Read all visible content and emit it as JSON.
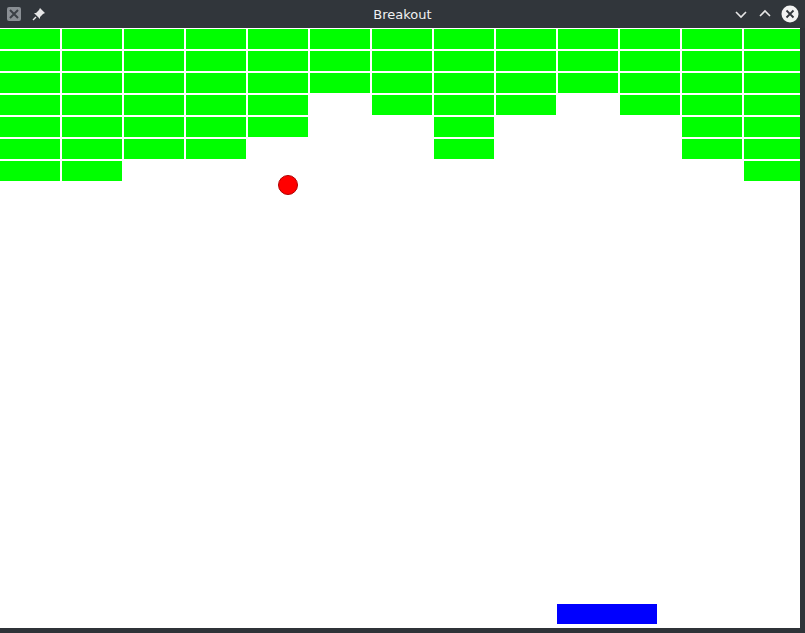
{
  "window": {
    "title": "Breakout"
  },
  "bricks": [
    [
      true,
      true,
      true,
      true,
      true,
      true,
      true,
      true,
      true,
      true,
      true,
      true,
      true
    ],
    [
      true,
      true,
      true,
      true,
      true,
      true,
      true,
      true,
      true,
      true,
      true,
      true,
      true
    ],
    [
      true,
      true,
      true,
      true,
      true,
      true,
      true,
      true,
      true,
      true,
      true,
      true,
      true
    ],
    [
      true,
      true,
      true,
      true,
      true,
      false,
      true,
      true,
      true,
      false,
      true,
      true,
      true
    ],
    [
      true,
      true,
      true,
      true,
      true,
      false,
      false,
      true,
      false,
      false,
      false,
      true,
      true
    ],
    [
      true,
      true,
      true,
      true,
      false,
      false,
      false,
      true,
      false,
      false,
      false,
      true,
      true
    ],
    [
      true,
      true,
      false,
      false,
      false,
      false,
      false,
      false,
      false,
      false,
      false,
      false,
      true
    ]
  ]
}
